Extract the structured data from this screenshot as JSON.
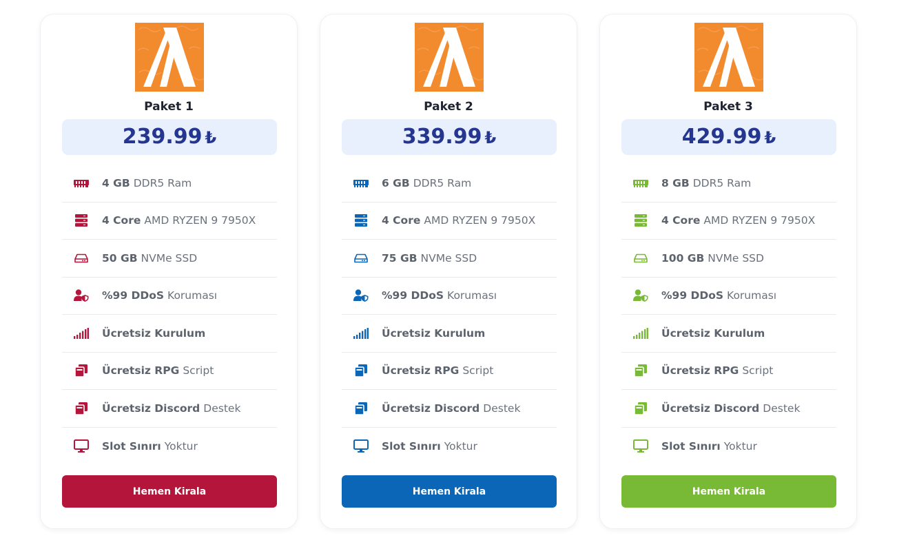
{
  "cards": [
    {
      "title": "Paket 1",
      "price": "239.99",
      "currency": "₺",
      "accent": "#b3163a",
      "features": [
        {
          "icon": "ram-icon",
          "bold": "4 GB",
          "rest": "DDR5 Ram"
        },
        {
          "icon": "server-icon",
          "bold": "4 Core",
          "rest": "AMD RYZEN 9 7950X"
        },
        {
          "icon": "hdd-icon",
          "bold": "50 GB",
          "rest": "NVMe SSD"
        },
        {
          "icon": "user-shield-icon",
          "bold": "%99 DDoS",
          "rest": "Koruması"
        },
        {
          "icon": "signal-icon",
          "bold": "Ücretsiz Kurulum",
          "rest": ""
        },
        {
          "icon": "copy-icon",
          "bold": "Ücretsiz RPG",
          "rest": "Script"
        },
        {
          "icon": "copy-icon",
          "bold": "Ücretsiz Discord",
          "rest": "Destek"
        },
        {
          "icon": "desktop-icon",
          "bold": "Slot Sınırı",
          "rest": "Yoktur"
        }
      ],
      "button": "Hemen Kirala"
    },
    {
      "title": "Paket 2",
      "price": "339.99",
      "currency": "₺",
      "accent": "#0b66b7",
      "features": [
        {
          "icon": "ram-icon",
          "bold": "6 GB",
          "rest": "DDR5 Ram"
        },
        {
          "icon": "server-icon",
          "bold": "4 Core",
          "rest": "AMD RYZEN 9 7950X"
        },
        {
          "icon": "hdd-icon",
          "bold": "75 GB",
          "rest": "NVMe SSD"
        },
        {
          "icon": "user-shield-icon",
          "bold": "%99 DDoS",
          "rest": "Koruması"
        },
        {
          "icon": "signal-icon",
          "bold": "Ücretsiz Kurulum",
          "rest": ""
        },
        {
          "icon": "copy-icon",
          "bold": "Ücretsiz RPG",
          "rest": "Script"
        },
        {
          "icon": "copy-icon",
          "bold": "Ücretsiz Discord",
          "rest": "Destek"
        },
        {
          "icon": "desktop-icon",
          "bold": "Slot Sınırı",
          "rest": "Yoktur"
        }
      ],
      "button": "Hemen Kirala"
    },
    {
      "title": "Paket 3",
      "price": "429.99",
      "currency": "₺",
      "accent": "#78b935",
      "features": [
        {
          "icon": "ram-icon",
          "bold": "8 GB",
          "rest": "DDR5 Ram"
        },
        {
          "icon": "server-icon",
          "bold": "4 Core",
          "rest": "AMD RYZEN 9 7950X"
        },
        {
          "icon": "hdd-icon",
          "bold": "100 GB",
          "rest": "NVMe SSD"
        },
        {
          "icon": "user-shield-icon",
          "bold": "%99 DDoS",
          "rest": "Koruması"
        },
        {
          "icon": "signal-icon",
          "bold": "Ücretsiz Kurulum",
          "rest": ""
        },
        {
          "icon": "copy-icon",
          "bold": "Ücretsiz RPG",
          "rest": "Script"
        },
        {
          "icon": "copy-icon",
          "bold": "Ücretsiz Discord",
          "rest": "Destek"
        },
        {
          "icon": "desktop-icon",
          "bold": "Slot Sınırı",
          "rest": "Yoktur"
        }
      ],
      "button": "Hemen Kirala"
    }
  ],
  "logo_icon": "fivem-logo-icon",
  "logo_color": "#f28a2e"
}
